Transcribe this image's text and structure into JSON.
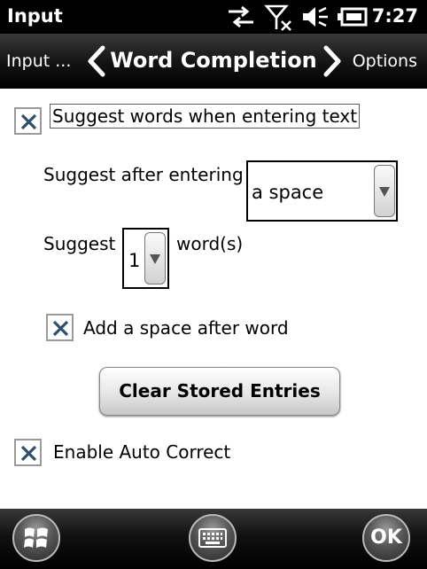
{
  "status_bar": {
    "app_title": "Input",
    "time": "7:27",
    "icons": [
      "data-sync-icon",
      "no-signal-icon",
      "volume-icon",
      "battery-icon"
    ]
  },
  "nav": {
    "prev_label": "Input ...",
    "title": "Word Completion",
    "next_label": "Options"
  },
  "settings": {
    "suggest_words_label": "Suggest words when entering text",
    "suggest_words_checked": true,
    "suggest_after_label": "Suggest after entering",
    "suggest_after_value": "a space",
    "suggest_count_label": "Suggest",
    "suggest_count_value": "1",
    "suggest_count_suffix": "word(s)",
    "add_space_label": "Add a space after word",
    "add_space_checked": true,
    "clear_button_label": "Clear Stored Entries",
    "auto_correct_label": "Enable Auto Correct",
    "auto_correct_checked": true
  },
  "bottom_bar": {
    "start_icon": "windows-logo-icon",
    "keyboard_icon": "keyboard-icon",
    "ok_label": "OK"
  },
  "colors": {
    "check_mark": "#2f4f6f",
    "bar_background": "#000000"
  }
}
